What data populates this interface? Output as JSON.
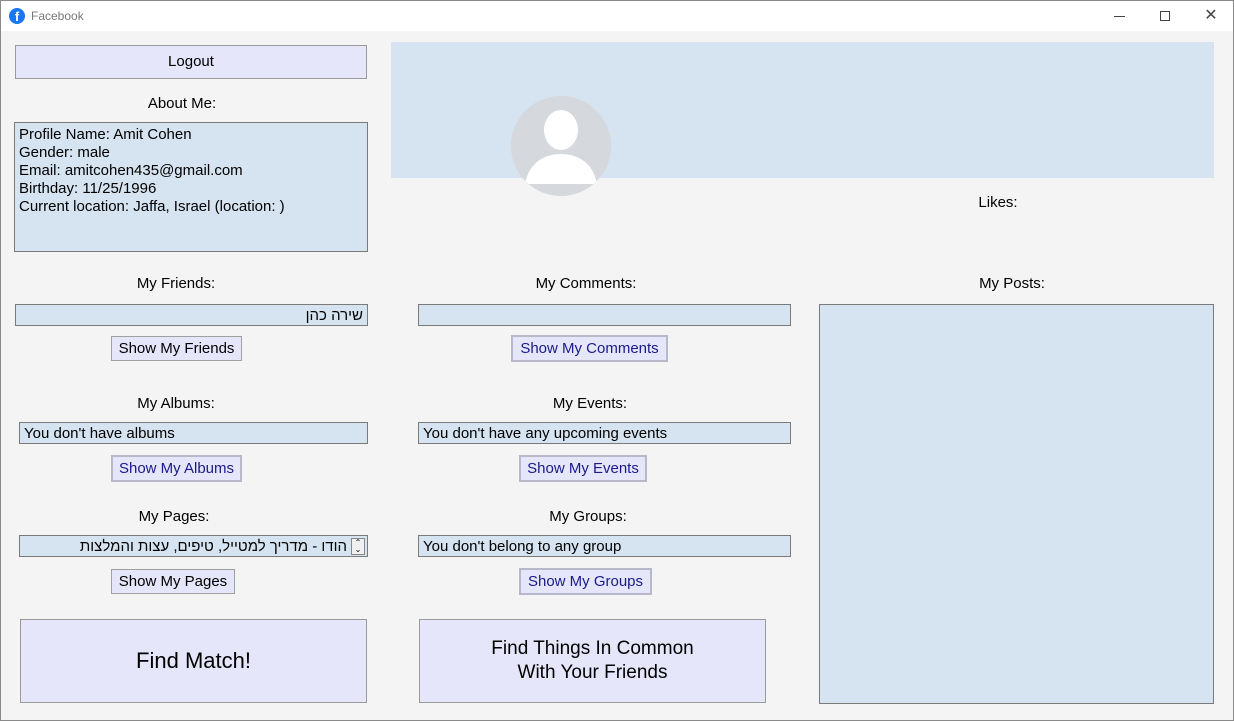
{
  "window": {
    "title": "Facebook",
    "app_icon": "f"
  },
  "buttons": {
    "logout": "Logout",
    "show_friends": "Show My Friends",
    "show_comments": "Show My Comments",
    "show_albums": "Show My Albums",
    "show_events": "Show My Events",
    "show_pages": "Show My Pages",
    "show_groups": "Show My Groups",
    "find_match": "Find Match!",
    "find_common_line1": "Find Things In Common",
    "find_common_line2": "With Your Friends"
  },
  "about": {
    "label": "About Me:",
    "lines": [
      "Profile Name: Amit Cohen",
      "Gender: male",
      "Email: amitcohen435@gmail.com",
      "Birthday: 11/25/1996",
      "Current location: Jaffa, Israel (location: )"
    ]
  },
  "labels": {
    "likes": "Likes:",
    "friends": "My Friends:",
    "comments": "My Comments:",
    "posts": "My Posts:",
    "albums": "My Albums:",
    "events": "My Events:",
    "pages": "My Pages:",
    "groups": "My Groups:"
  },
  "fields": {
    "friends": "שירה כהן",
    "comments": "",
    "albums": "You don't have albums",
    "events": "You don't have any upcoming events",
    "pages": "הודו - מדריך למטייל, טיפים, עצות והמלצות",
    "groups": "You don't belong to any group"
  },
  "colors": {
    "button_bg": "#e6e6fa",
    "field_bg": "#d6e3f0",
    "window_bg": "#f4f4f4",
    "brand": "#1877f2"
  }
}
